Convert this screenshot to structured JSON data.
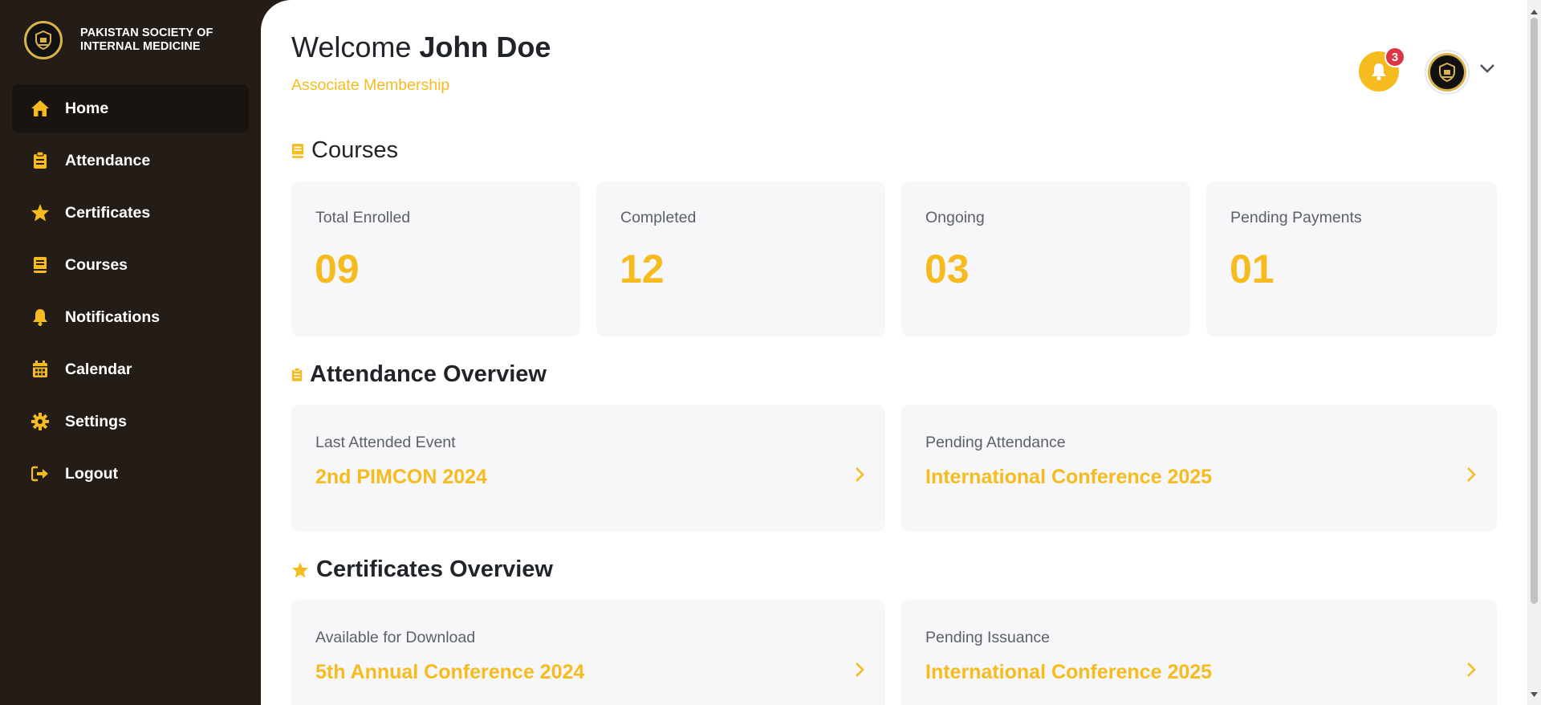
{
  "brand": {
    "name": "PAKISTAN SOCIETY OF INTERNAL MEDICINE",
    "icon": "psim-logo"
  },
  "sidebar": {
    "items": [
      {
        "label": "Home",
        "icon": "home-icon",
        "active": true
      },
      {
        "label": "Attendance",
        "icon": "clipboard-icon"
      },
      {
        "label": "Certificates",
        "icon": "star-icon"
      },
      {
        "label": "Courses",
        "icon": "book-icon"
      },
      {
        "label": "Notifications",
        "icon": "bell-icon"
      },
      {
        "label": "Calendar",
        "icon": "calendar-icon"
      },
      {
        "label": "Settings",
        "icon": "gear-icon"
      },
      {
        "label": "Logout",
        "icon": "logout-icon"
      }
    ]
  },
  "header": {
    "welcome": "Welcome",
    "user_name": "John Doe",
    "membership": "Associate Membership",
    "notification_count": "3"
  },
  "courses": {
    "title": "Courses",
    "stats": [
      {
        "label": "Total Enrolled",
        "value": "09"
      },
      {
        "label": "Completed",
        "value": "12"
      },
      {
        "label": "Ongoing",
        "value": "03"
      },
      {
        "label": "Pending Payments",
        "value": "01"
      }
    ]
  },
  "attendance": {
    "title": "Attendance Overview",
    "cards": [
      {
        "label": "Last Attended Event",
        "value": "2nd PIMCON 2024"
      },
      {
        "label": "Pending Attendance",
        "value": "International Conference 2025"
      }
    ]
  },
  "certificates": {
    "title": "Certificates Overview",
    "cards": [
      {
        "label": "Available for Download",
        "value": "5th Annual Conference 2024"
      },
      {
        "label": "Pending Issuance",
        "value": "International Conference 2025"
      }
    ]
  },
  "colors": {
    "accent": "#f6bb1e",
    "sidebar": "#231c17",
    "card": "#f7f7f9",
    "badge": "#dc3545"
  }
}
